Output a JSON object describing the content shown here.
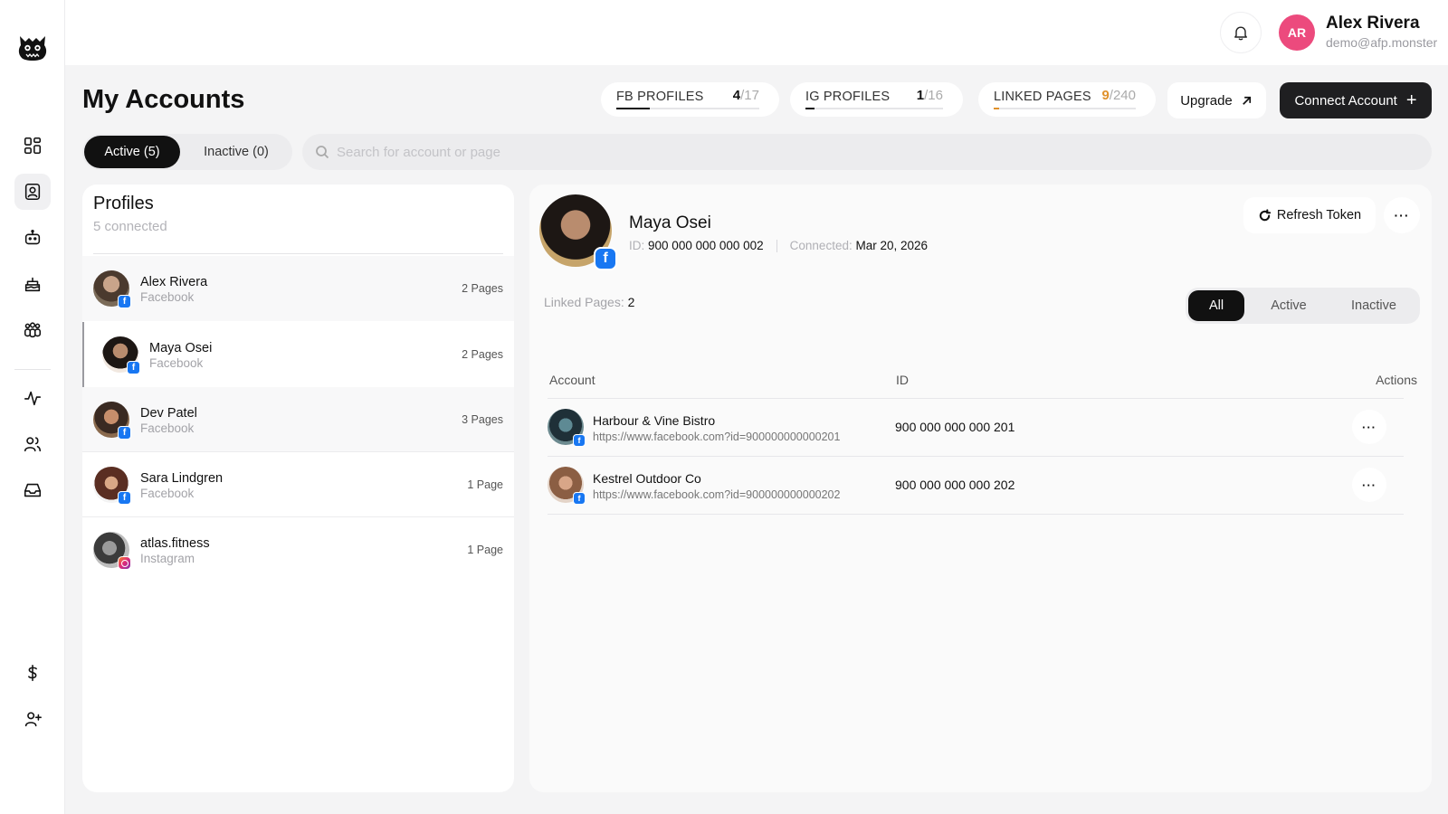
{
  "header": {
    "user_initials": "AR",
    "user_name": "Alex Rivera",
    "user_email": "demo@afp.monster",
    "more_label": "···"
  },
  "sidebar": {
    "items": [
      {
        "icon": "dashboard-icon",
        "active": false
      },
      {
        "icon": "accounts-icon",
        "active": true
      },
      {
        "icon": "bot-icon",
        "active": false
      },
      {
        "icon": "cake-icon",
        "active": false
      },
      {
        "icon": "group-icon",
        "active": false
      },
      {
        "icon": "activity-icon",
        "active": false
      },
      {
        "icon": "users-icon",
        "active": false
      },
      {
        "icon": "inbox-icon",
        "active": false
      },
      {
        "icon": "dollar-icon",
        "active": false
      },
      {
        "icon": "add-user-icon",
        "active": false
      }
    ]
  },
  "page": {
    "title": "My Accounts",
    "stats": [
      {
        "label": "FB PROFILES",
        "used": "4",
        "total": "/17",
        "ratio": 0.235,
        "accent": "#111111"
      },
      {
        "label": "IG PROFILES",
        "used": "1",
        "total": "/16",
        "ratio": 0.0625,
        "accent": "#111111"
      },
      {
        "label": "LINKED PAGES",
        "used": "9",
        "total": "/240",
        "ratio": 0.0375,
        "accent": "#e0912b"
      }
    ],
    "upgrade_label": "Upgrade",
    "connect_label": "Connect Account",
    "tab_active": "Active (5)",
    "tab_inactive": "Inactive (0)",
    "search_placeholder": "Search for account or page",
    "search_value": ""
  },
  "profiles": {
    "title": "Profiles",
    "subtitle": "5 connected",
    "items": [
      {
        "name": "Alex Rivera",
        "platform": "Facebook",
        "pages": "2 Pages",
        "network": "facebook"
      },
      {
        "name": "Maya Osei",
        "platform": "Facebook",
        "pages": "2 Pages",
        "network": "facebook"
      },
      {
        "name": "Dev Patel",
        "platform": "Facebook",
        "pages": "3 Pages",
        "network": "facebook"
      },
      {
        "name": "Sara Lindgren",
        "platform": "Facebook",
        "pages": "1 Page",
        "network": "facebook"
      },
      {
        "name": "atlas.fitness",
        "platform": "Instagram",
        "pages": "1 Page",
        "network": "instagram"
      }
    ]
  },
  "detail": {
    "name": "Maya Osei",
    "id_label": "ID:",
    "id_value": "900 000 000 000 002",
    "connected_label": "Connected:",
    "connected_value": "Mar 20, 2026",
    "refresh_label": "Refresh Token",
    "linked_label": "Linked Pages:",
    "linked_value": "2",
    "filters": [
      "All",
      "Active",
      "Inactive"
    ],
    "columns": {
      "account": "Account",
      "id": "ID",
      "actions": "Actions"
    },
    "rows": [
      {
        "name": "Harbour & Vine Bistro",
        "url": "https://www.facebook.com?id=900000000000201",
        "id": "900 000 000 000 201"
      },
      {
        "name": "Kestrel Outdoor Co",
        "url": "https://www.facebook.com?id=900000000000202",
        "id": "900 000 000 000 202"
      }
    ]
  },
  "colors": {
    "accent_dark": "#111111",
    "avatar_pink": "#ec4a7d",
    "facebook_blue": "#1877f2",
    "warning_orange": "#e0912b"
  }
}
